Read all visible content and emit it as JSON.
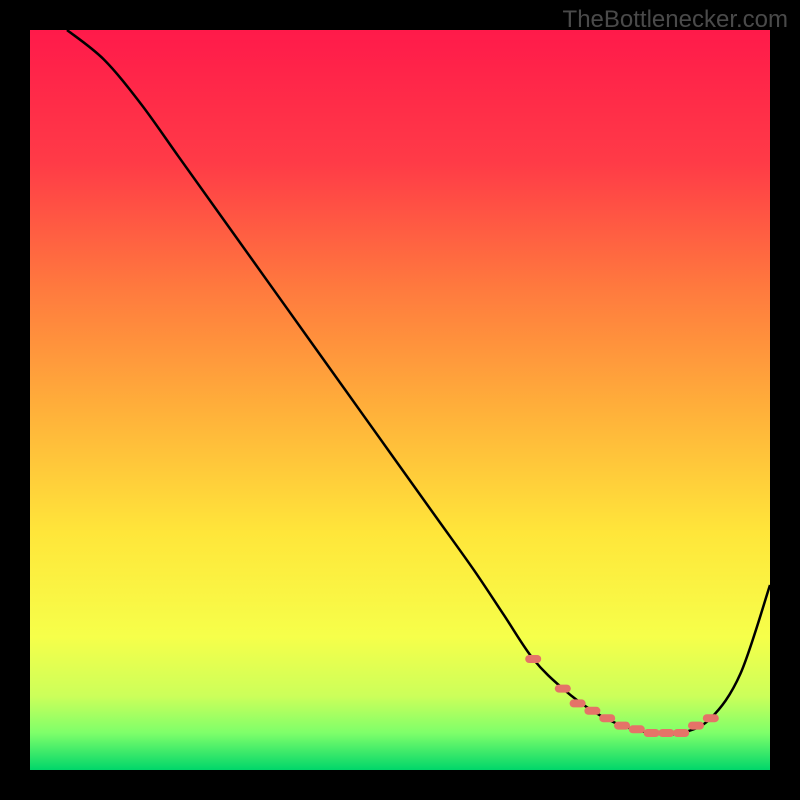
{
  "watermark": "TheBottlenecker.com",
  "chart_data": {
    "type": "line",
    "title": "",
    "xlabel": "",
    "ylabel": "",
    "xlim": [
      0,
      100
    ],
    "ylim": [
      0,
      100
    ],
    "series": [
      {
        "name": "bottleneck-curve",
        "x": [
          5,
          10,
          15,
          20,
          25,
          30,
          35,
          40,
          45,
          50,
          55,
          60,
          64,
          68,
          72,
          76,
          80,
          84,
          88,
          92,
          96,
          100
        ],
        "y": [
          100,
          96,
          90,
          83,
          76,
          69,
          62,
          55,
          48,
          41,
          34,
          27,
          21,
          15,
          11,
          8,
          6,
          5,
          5,
          7,
          13,
          25
        ]
      }
    ],
    "markers": {
      "name": "optimal-markers",
      "x": [
        68,
        72,
        74,
        76,
        78,
        80,
        82,
        84,
        86,
        88,
        90,
        92
      ],
      "y": [
        15,
        11,
        9,
        8,
        7,
        6,
        5.5,
        5,
        5,
        5,
        6,
        7
      ]
    },
    "background_gradient": {
      "stops": [
        {
          "offset": 0.0,
          "color": "#ff1a4a"
        },
        {
          "offset": 0.18,
          "color": "#ff3b47"
        },
        {
          "offset": 0.35,
          "color": "#ff7a3e"
        },
        {
          "offset": 0.52,
          "color": "#ffb23a"
        },
        {
          "offset": 0.68,
          "color": "#ffe63a"
        },
        {
          "offset": 0.82,
          "color": "#f6ff4a"
        },
        {
          "offset": 0.9,
          "color": "#ccff5a"
        },
        {
          "offset": 0.95,
          "color": "#7eff6a"
        },
        {
          "offset": 1.0,
          "color": "#00d66a"
        }
      ]
    }
  }
}
